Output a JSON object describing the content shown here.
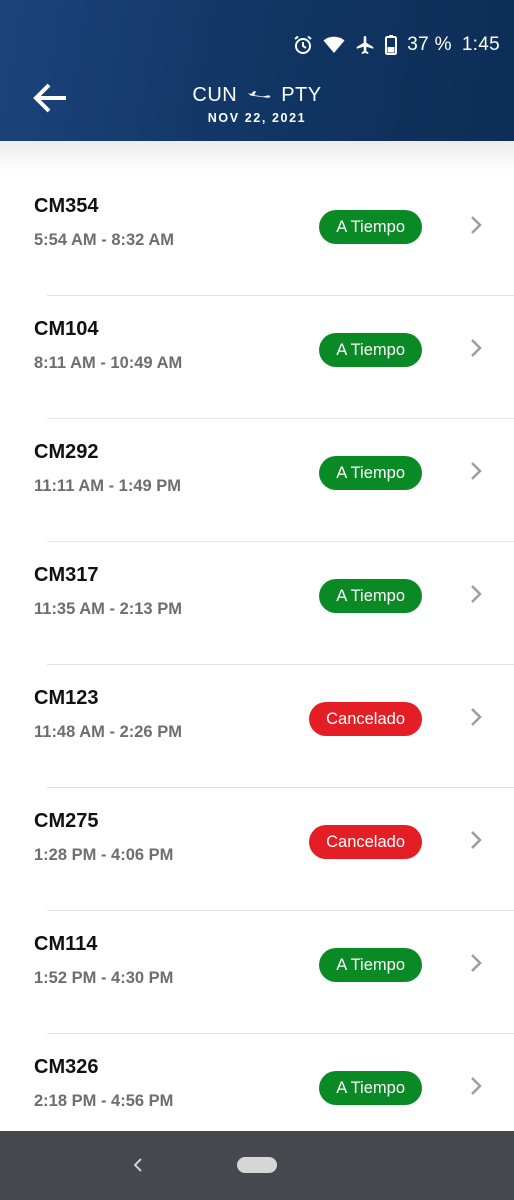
{
  "status_bar": {
    "battery": "37 %",
    "time": "1:45"
  },
  "header": {
    "origin": "CUN",
    "destination": "PTY",
    "date": "NOV 22, 2021"
  },
  "colors": {
    "header": "#123766",
    "on_time": "#0a8a24",
    "cancelled": "#e31e24",
    "nav_bar": "#45484c"
  },
  "flights": [
    {
      "code": "CM354",
      "time": "5:54 AM - 8:32 AM",
      "status": "A Tiempo",
      "type": "ontime"
    },
    {
      "code": "CM104",
      "time": "8:11 AM - 10:49 AM",
      "status": "A Tiempo",
      "type": "ontime"
    },
    {
      "code": "CM292",
      "time": "11:11 AM - 1:49 PM",
      "status": "A Tiempo",
      "type": "ontime"
    },
    {
      "code": "CM317",
      "time": "11:35 AM - 2:13 PM",
      "status": "A Tiempo",
      "type": "ontime"
    },
    {
      "code": "CM123",
      "time": "11:48 AM - 2:26 PM",
      "status": "Cancelado",
      "type": "cancel"
    },
    {
      "code": "CM275",
      "time": "1:28 PM - 4:06 PM",
      "status": "Cancelado",
      "type": "cancel"
    },
    {
      "code": "CM114",
      "time": "1:52 PM - 4:30 PM",
      "status": "A Tiempo",
      "type": "ontime"
    },
    {
      "code": "CM326",
      "time": "2:18 PM - 4:56 PM",
      "status": "A Tiempo",
      "type": "ontime"
    }
  ]
}
